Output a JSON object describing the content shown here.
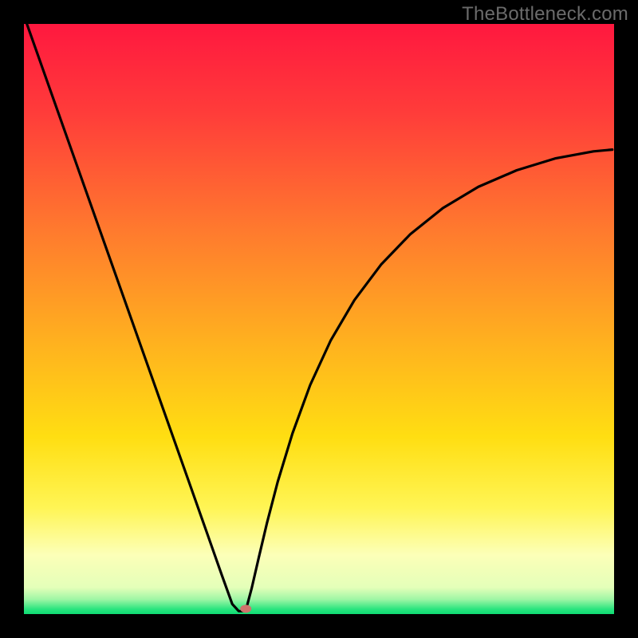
{
  "watermark": "TheBottleneck.com",
  "chart_data": {
    "type": "line",
    "title": "",
    "xlabel": "",
    "ylabel": "",
    "xlim": [
      0,
      100
    ],
    "ylim": [
      0,
      100
    ],
    "gradient_stops": [
      {
        "offset": 0.0,
        "color": "#ff183f"
      },
      {
        "offset": 0.15,
        "color": "#ff3c3a"
      },
      {
        "offset": 0.35,
        "color": "#ff7a2e"
      },
      {
        "offset": 0.55,
        "color": "#ffb41e"
      },
      {
        "offset": 0.7,
        "color": "#ffde12"
      },
      {
        "offset": 0.82,
        "color": "#fff555"
      },
      {
        "offset": 0.9,
        "color": "#fcffb8"
      },
      {
        "offset": 0.955,
        "color": "#e4ffb9"
      },
      {
        "offset": 0.975,
        "color": "#9ff6a5"
      },
      {
        "offset": 0.992,
        "color": "#28e47e"
      },
      {
        "offset": 1.0,
        "color": "#0fdc73"
      }
    ],
    "series": [
      {
        "name": "bottleneck-curve",
        "x": [
          0.5,
          4,
          8,
          12,
          16,
          20,
          24,
          28,
          31,
          33.5,
          35.3,
          36.4,
          37.0,
          37.3,
          37.8,
          38.6,
          39.8,
          41.2,
          43.0,
          45.5,
          48.5,
          52,
          56,
          60.5,
          65.5,
          71,
          77,
          83.5,
          90,
          96.5,
          99.7
        ],
        "y": [
          100,
          90.1,
          78.8,
          67.5,
          56.2,
          44.9,
          33.6,
          22.3,
          13.8,
          6.7,
          1.7,
          0.5,
          0.5,
          0.5,
          1.4,
          4.4,
          9.6,
          15.5,
          22.4,
          30.6,
          38.8,
          46.4,
          53.2,
          59.2,
          64.4,
          68.8,
          72.4,
          75.2,
          77.2,
          78.4,
          78.7
        ]
      }
    ],
    "marker": {
      "x": 37.6,
      "y": 0.9,
      "color": "#cf746c",
      "rx": 7,
      "ry": 5
    }
  }
}
